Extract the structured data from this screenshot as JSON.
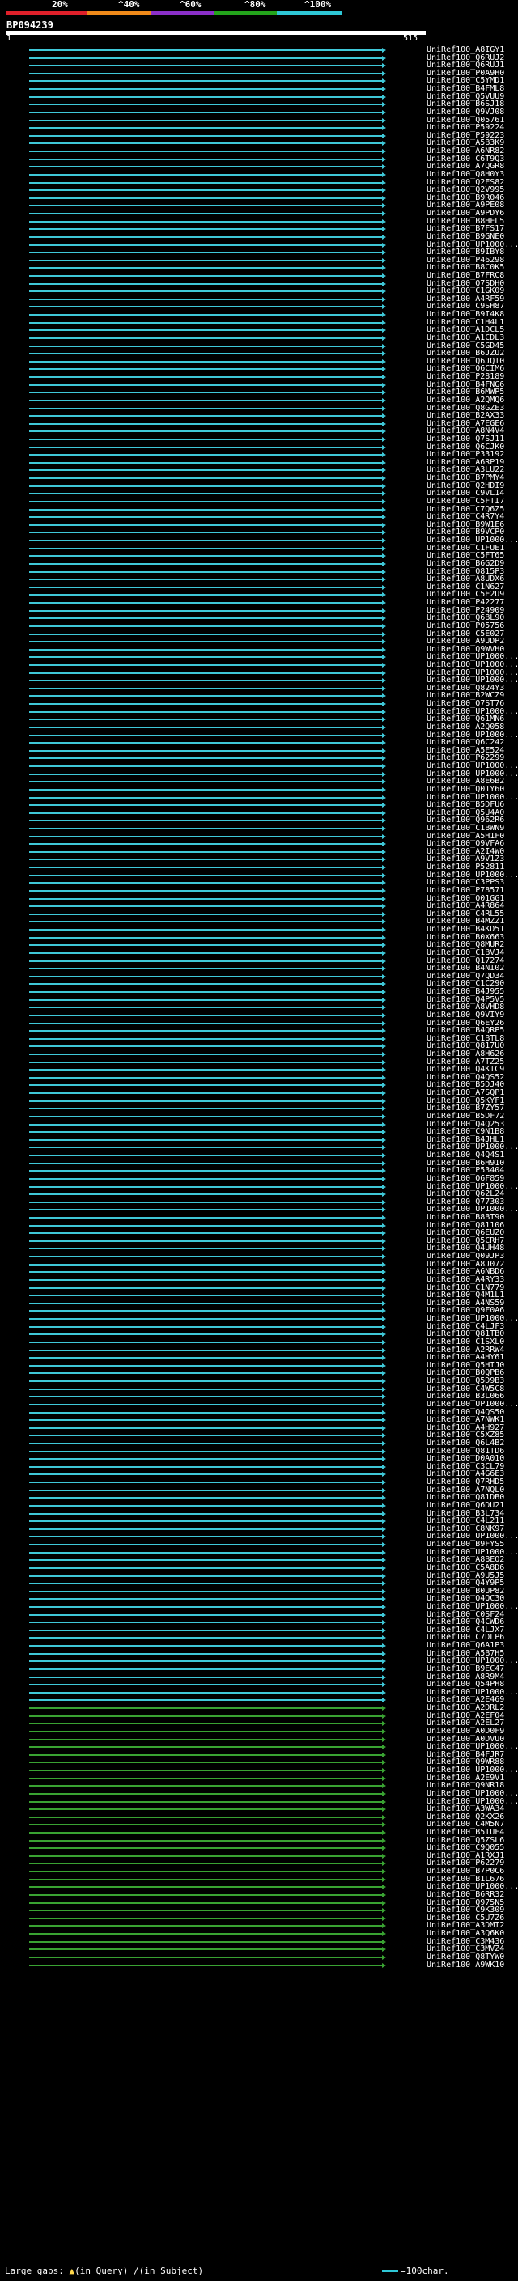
{
  "legend": {
    "labels": [
      "20%",
      "^40%",
      "^60%",
      "^80%",
      "^100%"
    ],
    "colors": [
      "#e0202a",
      "#f08a1a",
      "#8b2fc9",
      "#24a51c",
      "#2ec7d6"
    ]
  },
  "query": {
    "title": "BP094239",
    "scale_start": "1",
    "scale_end": "515"
  },
  "colors": {
    "hit_high": "#3fc8d8",
    "hit_mid": "#39a232",
    "background": "#000000"
  },
  "hits": [
    "UniRef100_A8IGY1",
    "UniRef100_Q6RUJ2",
    "UniRef100_Q6RUJ1",
    "UniRef100_P0A9H0",
    "UniRef100_C5YMD1",
    "UniRef100_B4FML8",
    "UniRef100_Q5VUU9",
    "UniRef100_B6SJ18",
    "UniRef100_Q9VJ08",
    "UniRef100_Q05761",
    "UniRef100_P59224",
    "UniRef100_P59223",
    "UniRef100_A5B3K9",
    "UniRef100_A6NR82",
    "UniRef100_C6T9Q3",
    "UniRef100_A7QGR8",
    "UniRef100_Q8H0Y3",
    "UniRef100_Q2ES82",
    "UniRef100_Q2V995",
    "UniRef100_B9R046",
    "UniRef100_A9PE08",
    "UniRef100_A9PDY6",
    "UniRef100_B8HFL5",
    "UniRef100_B7FS17",
    "UniRef100_B9GNE0",
    "UniRef100_UP1000...",
    "UniRef100_B9IBY8",
    "UniRef100_P46298",
    "UniRef100_B8C0K5",
    "UniRef100_B7FRC8",
    "UniRef100_Q7SDH0",
    "UniRef100_C1GK09",
    "UniRef100_A4RF59",
    "UniRef100_C9SH87",
    "UniRef100_B9I4K8",
    "UniRef100_C1H4L1",
    "UniRef100_A1DCL5",
    "UniRef100_A1CDL3",
    "UniRef100_C5GD45",
    "UniRef100_B6JZU2",
    "UniRef100_Q6JQT0",
    "UniRef100_Q6CIM6",
    "UniRef100_P28189",
    "UniRef100_B4FNG6",
    "UniRef100_B6MWP5",
    "UniRef100_A2QMQ6",
    "UniRef100_Q8GZE3",
    "UniRef100_B2AX33",
    "UniRef100_A7EGE6",
    "UniRef100_A8N4V4",
    "UniRef100_Q7SJ11",
    "UniRef100_Q6CJK0",
    "UniRef100_P33192",
    "UniRef100_A6RP19",
    "UniRef100_A3LU22",
    "UniRef100_B7PMY4",
    "UniRef100_Q2HDI9",
    "UniRef100_C9VL14",
    "UniRef100_C5FTI7",
    "UniRef100_C7Q6Z5",
    "UniRef100_C4R7Y4",
    "UniRef100_B9W1E6",
    "UniRef100_B9VCP0",
    "UniRef100_UP1000...",
    "UniRef100_C1FUE1",
    "UniRef100_C5FT65",
    "UniRef100_B6G2D9",
    "UniRef100_Q815P3",
    "UniRef100_A8UDX6",
    "UniRef100_C1N627",
    "UniRef100_C5E2U9",
    "UniRef100_P42277",
    "UniRef100_P24909",
    "UniRef100_Q6BL90",
    "UniRef100_P05756",
    "UniRef100_C5E027",
    "UniRef100_A9UDP2",
    "UniRef100_Q9WVH0",
    "UniRef100_UP1000...",
    "UniRef100_UP1000...",
    "UniRef100_UP1000...",
    "UniRef100_UP1000...",
    "UniRef100_Q824Y3",
    "UniRef100_B2WCZ9",
    "UniRef100_Q7ST76",
    "UniRef100_UP1000...",
    "UniRef100_Q61MN6",
    "UniRef100_A2Q058",
    "UniRef100_UP1000...",
    "UniRef100_Q6C242",
    "UniRef100_A5E524",
    "UniRef100_P62299",
    "UniRef100_UP1000...",
    "UniRef100_UP1000...",
    "UniRef100_A8E6B2",
    "UniRef100_Q01Y60",
    "UniRef100_UP1000...",
    "UniRef100_B5DFU6",
    "UniRef100_Q5U4A0",
    "UniRef100_Q962R6",
    "UniRef100_C1BWN9",
    "UniRef100_A5H1F0",
    "UniRef100_Q9VFA6",
    "UniRef100_A2I4W0",
    "UniRef100_A9V1Z3",
    "UniRef100_P52811",
    "UniRef100_UP1000...",
    "UniRef100_C3PPS3",
    "UniRef100_P78571",
    "UniRef100_Q01GG1",
    "UniRef100_A4R864",
    "UniRef100_C4RL55",
    "UniRef100_B4MZZ1",
    "UniRef100_B4KD51",
    "UniRef100_B0X663",
    "UniRef100_Q8MUR2",
    "UniRef100_C1BVJ4",
    "UniRef100_Q17274",
    "UniRef100_B4NI02",
    "UniRef100_Q7QD34",
    "UniRef100_C1C290",
    "UniRef100_B4J955",
    "UniRef100_Q4P5V5",
    "UniRef100_A8VHD8",
    "UniRef100_Q9VIY9",
    "UniRef100_Q6EY26",
    "UniRef100_B4QRP5",
    "UniRef100_C1BTL8",
    "UniRef100_Q817U0",
    "UniRef100_A8H626",
    "UniRef100_A7TZ25",
    "UniRef100_Q4KTC9",
    "UniRef100_Q4QS52",
    "UniRef100_B5DJ40",
    "UniRef100_A7SQP1",
    "UniRef100_Q5KYF1",
    "UniRef100_B7ZY57",
    "UniRef100_B5DF72",
    "UniRef100_Q4Q253",
    "UniRef100_C9N1B8",
    "UniRef100_B4JHL1",
    "UniRef100_UP1000...",
    "UniRef100_Q4Q4S1",
    "UniRef100_B6H910",
    "UniRef100_P53404",
    "UniRef100_Q6F859",
    "UniRef100_UP1000...",
    "UniRef100_Q62L24",
    "UniRef100_Q77303",
    "UniRef100_UP1000...",
    "UniRef100_B8BT90",
    "UniRef100_Q81106",
    "UniRef100_Q6EUZ0",
    "UniRef100_Q5CRH7",
    "UniRef100_Q4UH48",
    "UniRef100_Q09JP3",
    "UniRef100_A8J072",
    "UniRef100_A6NBD6",
    "UniRef100_A4RY33",
    "UniRef100_C1N779",
    "UniRef100_Q4M1L1",
    "UniRef100_A4NS59",
    "UniRef100_Q9F0A6",
    "UniRef100_UP1000...",
    "UniRef100_C4LJF3",
    "UniRef100_Q81TB0",
    "UniRef100_C1SXL0",
    "UniRef100_A2RRW4",
    "UniRef100_A4HY61",
    "UniRef100_Q5HIJ0",
    "UniRef100_B0QPB6",
    "UniRef100_Q5D9B3",
    "UniRef100_C4W5C8",
    "UniRef100_B3L066",
    "UniRef100_UP1000...",
    "UniRef100_Q4QS50",
    "UniRef100_A7NWK1",
    "UniRef100_A4H927",
    "UniRef100_C5XZ85",
    "UniRef100_Q6L4B2",
    "UniRef100_Q81TD6",
    "UniRef100_D0A010",
    "UniRef100_C3CL79",
    "UniRef100_A4G6E3",
    "UniRef100_Q7RHD5",
    "UniRef100_A7NQL0",
    "UniRef100_Q81DB0",
    "UniRef100_Q6DU21",
    "UniRef100_B3L734",
    "UniRef100_C4L211",
    "UniRef100_C8NK97",
    "UniRef100_UP1000...",
    "UniRef100_B9FYS5",
    "UniRef100_UP1000...",
    "UniRef100_A8BEQ2",
    "UniRef100_C5A8D6",
    "UniRef100_A9U5J5",
    "UniRef100_Q4Y9P5",
    "UniRef100_B0UP82",
    "UniRef100_Q4QC30",
    "UniRef100_UP1000...",
    "UniRef100_C0SF24",
    "UniRef100_Q4CWD6",
    "UniRef100_C4LJX7",
    "UniRef100_C7DLP6",
    "UniRef100_Q6A1P3",
    "UniRef100_A5B7H5",
    "UniRef100_UP1000...",
    "UniRef100_B9EC47",
    "UniRef100_A8R9M4",
    "UniRef100_Q54PH8",
    "UniRef100_UP1000...",
    "UniRef100_A2E469",
    "UniRef100_A2DRL2",
    "UniRef100_A2EF04",
    "UniRef100_A2EL27",
    "UniRef100_A0D0F9",
    "UniRef100_A0DVU0",
    "UniRef100_UP1000...",
    "UniRef100_B4FJR7",
    "UniRef100_Q9WR88",
    "UniRef100_UP1000...",
    "UniRef100_A2E9V1",
    "UniRef100_Q9NR18",
    "UniRef100_UP1000...",
    "UniRef100_UP1000...",
    "UniRef100_A3WA34",
    "UniRef100_Q2KX26",
    "UniRef100_C4M5N7",
    "UniRef100_B5IUF4",
    "UniRef100_Q5ZSL6",
    "UniRef100_C9Q055",
    "UniRef100_A1RXJ1",
    "UniRef100_P62279",
    "UniRef100_B7P0C6",
    "UniRef100_B1L676",
    "UniRef100_UP1000...",
    "UniRef100_B6RR32",
    "UniRef100_Q975N5",
    "UniRef100_C9K309",
    "UniRef100_C5U7Z6",
    "UniRef100_A3DMT2",
    "UniRef100_A3Q6K0",
    "UniRef100_C3M436",
    "UniRef100_C3MVZ4",
    "UniRef100_Q8TYW0",
    "UniRef100_A9WK10"
  ],
  "footer": {
    "large_gaps_label": "Large gaps:",
    "query_gap_mark": "▲",
    "query_gap_text": "(in Query)",
    "subject_gap_mark": "/",
    "subject_gap_text": "(in Subject)",
    "scale_text": "=100char."
  }
}
